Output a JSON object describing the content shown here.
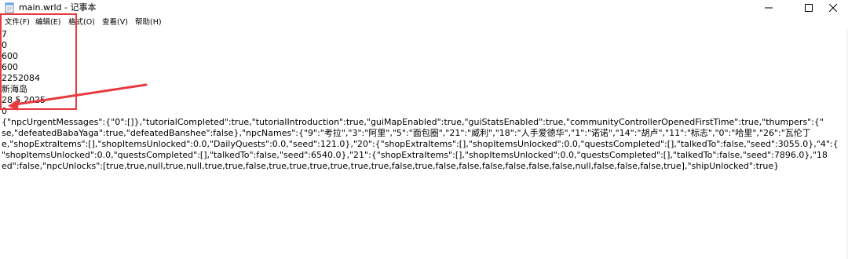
{
  "window": {
    "title": "main.wrld - 记事本",
    "controls": {
      "minimize": "—",
      "maximize": "☐",
      "close": "✕"
    }
  },
  "menu": {
    "items": [
      {
        "label": "文件(F)"
      },
      {
        "label": "编辑(E)"
      },
      {
        "label": "格式(O)"
      },
      {
        "label": "查看(V)"
      },
      {
        "label": "帮助(H)"
      }
    ]
  },
  "editor": {
    "lines": [
      "7",
      "0",
      "600",
      "600",
      "2252084",
      "新海岛",
      "28.5.2025",
      "0",
      "{\"npcUrgentMessages\":{\"0\":[]},\"tutorialCompleted\":true,\"tutorialIntroduction\":true,\"guiMapEnabled\":true,\"guiStatsEnabled\":true,\"communityControllerOpenedFirstTime\":true,\"thumpers\":{\"",
      "se,\"defeatedBabaYaga\":true,\"defeatedBanshee\":false},\"npcNames\":{\"9\":\"考拉\",\"3\":\"阿里\",\"5\":\"面包圈\",\"21\":\"威利\",\"18\":\"人手爱德华\",\"1\":\"诺诺\",\"14\":\"胡卢\",\"11\":\"标志\",\"0\":\"哈里\",\"26\":\"瓦伦丁",
      "e,\"shopExtraItems\":[],\"shopItemsUnlocked\":0.0,\"DailyQuests\":0.0,\"seed\":121.0},\"20\":{\"shopExtraItems\":[],\"shopItemsUnlocked\":0.0,\"questsCompleted\":[],\"talkedTo\":false,\"seed\":3055.0},\"4\":{",
      "\"shopItemsUnlocked\":0.0,\"questsCompleted\":[],\"talkedTo\":false,\"seed\":6540.0},\"21\":{\"shopExtraItems\":[],\"shopItemsUnlocked\":0.0,\"questsCompleted\":[],\"talkedTo\":false,\"seed\":7896.0},\"18",
      "ed\":false,\"npcUnlocks\":[true,true,null,true,null,true,true,false,true,true,true,true,true,true,false,true,false,false,false,false,false,false,null,false,false,false,true],\"shipUnlocked\":true}"
    ]
  },
  "annotation": {
    "color": "#e8393f"
  },
  "icons": {
    "app": "notepad-icon"
  }
}
